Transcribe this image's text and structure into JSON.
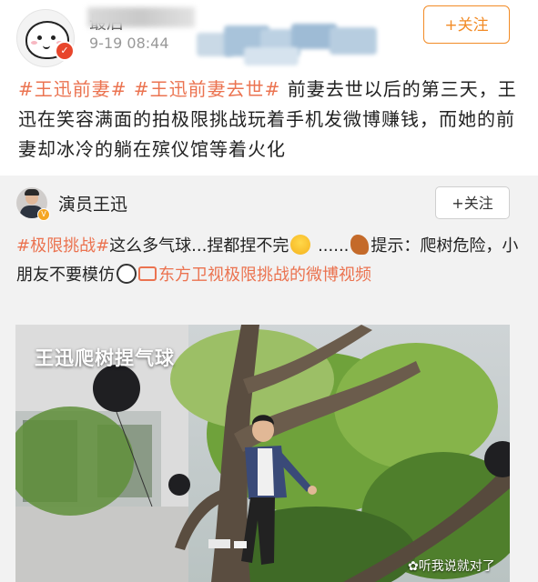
{
  "post": {
    "username": "最后",
    "time": "9-19 08:44",
    "follow_label": "+关注",
    "text": {
      "tag1": "#王迅前妻#",
      "tag2": "#王迅前妻去世#",
      "body": "前妻去世以后的第三天，王迅在笑容满面的拍极限挑战玩着手机发微博赚钱，而她的前妻却冰冷的躺在殡仪馆等着火化"
    }
  },
  "repost": {
    "username": "演员王迅",
    "follow_label": "+关注",
    "text": {
      "tag": "#极限挑战#",
      "part1": "这么多气球...捏都捏不完",
      "part2": "......",
      "part3": "提示：爬树危险，小朋友不要模仿",
      "video_link": "东方卫视极限挑战的微博视频"
    },
    "media": {
      "caption": "王迅爬树捏气球",
      "watermark": "听我说就对了"
    }
  },
  "colors": {
    "accent": "#eb7350",
    "follow_orange": "#f28b26"
  }
}
